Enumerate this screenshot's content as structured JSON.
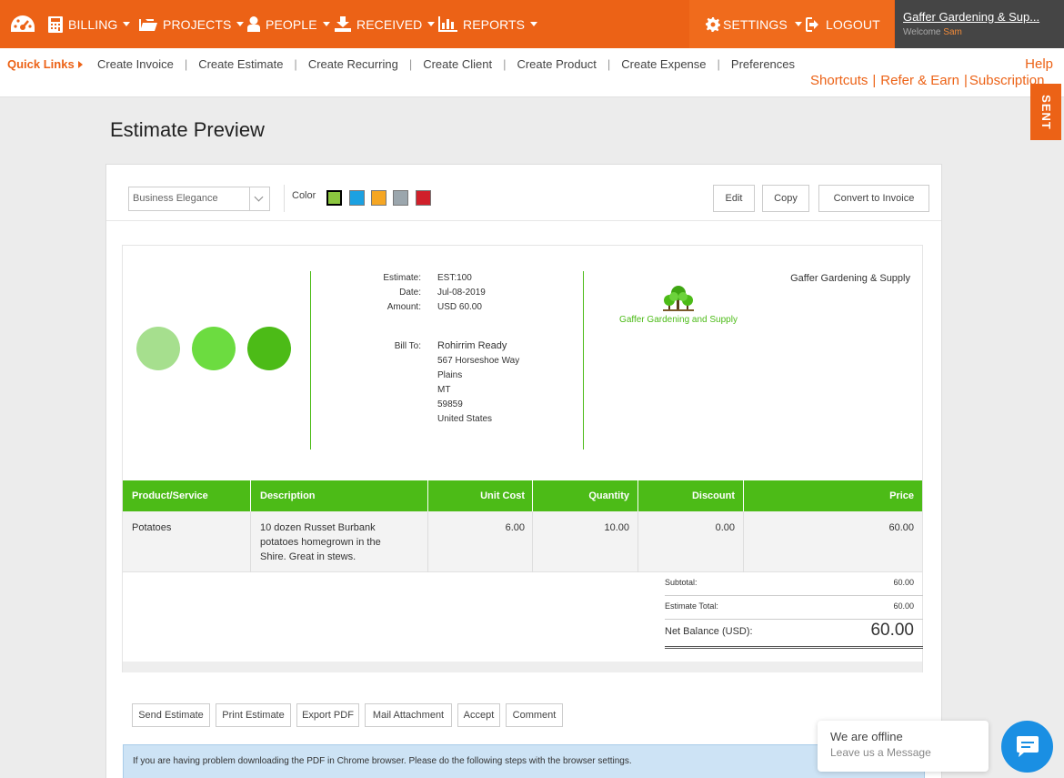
{
  "nav": {
    "items": [
      {
        "label": "BILLING"
      },
      {
        "label": "PROJECTS"
      },
      {
        "label": "PEOPLE"
      },
      {
        "label": "RECEIVED"
      },
      {
        "label": "REPORTS"
      }
    ],
    "settings": "SETTINGS",
    "logout": "LOGOUT",
    "user": {
      "name": "Gaffer Gardening & Sup...",
      "welcome": "Welcome",
      "first_name": "Sam"
    }
  },
  "quick_links": {
    "title": "Quick Links",
    "links": [
      "Create Invoice",
      "Create Estimate",
      "Create Recurring",
      "Create Client",
      "Create Product",
      "Create Expense",
      "Preferences"
    ],
    "help": "Help",
    "shortcuts": [
      "Shortcuts",
      "Refer & Earn",
      "Subscription"
    ]
  },
  "status_tab": "SENT",
  "page_title": "Estimate Preview",
  "toolbar": {
    "template": "Business Elegance",
    "color_label": "Color",
    "colors": [
      "#8cc63f",
      "#1ba1e2",
      "#f5a623",
      "#9ba6ad",
      "#d0202a"
    ],
    "selected_color": "#8cc63f",
    "edit": "Edit",
    "copy": "Copy",
    "convert": "Convert to Invoice"
  },
  "estimate": {
    "circle_colors": [
      "#a6df8e",
      "#6cdc40",
      "#4cbb17"
    ],
    "accent": "#4cbb17",
    "labels": {
      "estimate": "Estimate:",
      "date": "Date:",
      "amount": "Amount:",
      "bill_to": "Bill To:"
    },
    "number": "EST:100",
    "date": "Jul-08-2019",
    "amount": "USD 60.00",
    "bill_to": [
      "Rohirrim Ready",
      "567 Horseshoe Way",
      "Plains",
      "MT",
      "59859",
      "United States"
    ],
    "logo_text": "Gaffer Gardening and Supply",
    "company": "Gaffer Gardening & Supply",
    "columns": [
      "Product/Service",
      "Description",
      "Unit Cost",
      "Quantity",
      "Discount",
      "Price"
    ],
    "rows": [
      {
        "product": "Potatoes",
        "description": [
          "10 dozen Russet Burbank",
          "potatoes homegrown in the",
          "Shire. Great in stews."
        ],
        "unit_cost": "6.00",
        "quantity": "10.00",
        "discount": "0.00",
        "price": "60.00"
      }
    ],
    "totals": {
      "subtotal_label": "Subtotal:",
      "subtotal": "60.00",
      "total_label": "Estimate Total:",
      "total": "60.00",
      "net_label": "Net Balance (USD):",
      "net": "60.00"
    }
  },
  "actions": [
    "Send Estimate",
    "Print Estimate",
    "Export PDF",
    "Mail Attachment",
    "Accept",
    "Comment"
  ],
  "banner": "If you are having problem downloading the PDF in Chrome browser. Please do the following steps with the browser settings.",
  "chat": {
    "title": "We are offline",
    "subtitle": "Leave us a Message"
  }
}
